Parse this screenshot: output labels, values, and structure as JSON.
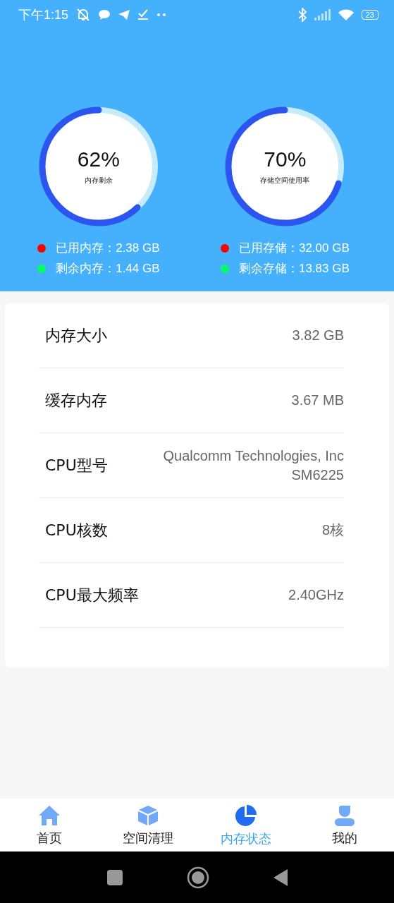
{
  "status_bar": {
    "time": "下午1:15",
    "battery": "23"
  },
  "gauges": [
    {
      "percent": "62%",
      "caption": "内存剩余",
      "legend": [
        {
          "label": "已用内存：2.38 GB",
          "color": "#ff0000"
        },
        {
          "label": "剩余内存：1.44 GB",
          "color": "#00ff66"
        }
      ]
    },
    {
      "percent": "70%",
      "caption": "存储空间使用率",
      "legend": [
        {
          "label": "已用存储：32.00 GB",
          "color": "#ff0000"
        },
        {
          "label": "剩余存储：13.83 GB",
          "color": "#00ff66"
        }
      ]
    }
  ],
  "info_rows": [
    {
      "label": "内存大小",
      "value": [
        "3.82 GB"
      ]
    },
    {
      "label": "缓存内存",
      "value": [
        "3.67 MB"
      ]
    },
    {
      "label": "CPU型号",
      "value": [
        "Qualcomm Technologies, Inc",
        "SM6225"
      ]
    },
    {
      "label": "CPU核数",
      "value": [
        "8核"
      ]
    },
    {
      "label": "CPU最大频率",
      "value": [
        "2.40GHz"
      ]
    }
  ],
  "tabs": [
    {
      "label": "首页",
      "kind": "home",
      "selected": false
    },
    {
      "label": "空间清理",
      "kind": "cube",
      "selected": false
    },
    {
      "label": "内存状态",
      "kind": "pie",
      "selected": true
    },
    {
      "label": "我的",
      "kind": "person",
      "selected": false
    }
  ]
}
